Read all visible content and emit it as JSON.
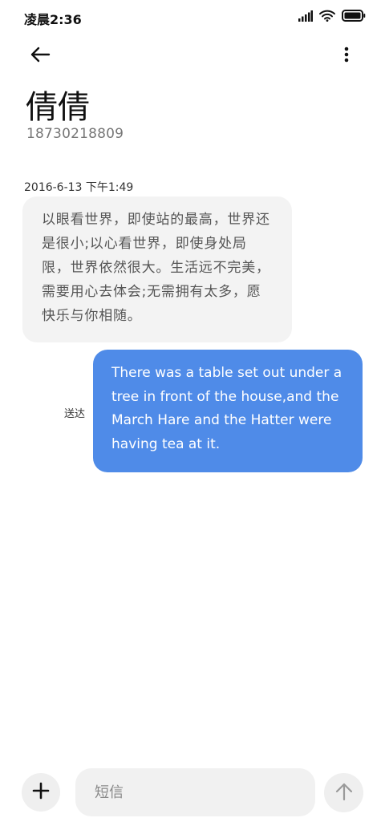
{
  "status_bar": {
    "time": "凌晨2:36",
    "icons": [
      "signal-icon",
      "wifi-icon",
      "battery-icon"
    ]
  },
  "top_bar": {
    "icons": [
      "back-arrow-icon",
      "more-vertical-icon"
    ]
  },
  "contact": {
    "name": "倩倩",
    "phone": "18730218809"
  },
  "messages": [
    {
      "timestamp": "2016-6-13 下午1:49",
      "direction": "incoming",
      "text": "以眼看世界，即使站的最高，世界还是很小;以心看世界，即使身处局限，世界依然很大。生活远不完美，需要用心去体会;无需拥有太多，愿快乐与你相随。"
    },
    {
      "direction": "outgoing",
      "status": "送达",
      "text": "There was a table set out under a tree in front of the house,and the March Hare and the Hatter were having tea at it."
    }
  ],
  "composer": {
    "placeholder": "短信",
    "value": "",
    "icons": [
      "plus-icon",
      "send-arrow-icon"
    ]
  },
  "colors": {
    "outgoing_bubble": "#4f8be8",
    "incoming_bubble": "#f3f3f3",
    "input_background": "#f1f1f1"
  }
}
